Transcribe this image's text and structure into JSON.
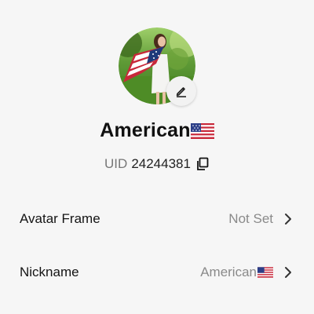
{
  "profile": {
    "display_name": "American",
    "flag_icon": "us-flag-icon",
    "uid_label": "UID",
    "uid_value": "24244381"
  },
  "settings": [
    {
      "label": "Avatar Frame",
      "value": "Not Set"
    },
    {
      "label": "Nickname",
      "value": "American"
    }
  ],
  "colors": {
    "background": "#f6f6f6",
    "primary_text": "#141414",
    "secondary_text": "#8a8a8a"
  }
}
